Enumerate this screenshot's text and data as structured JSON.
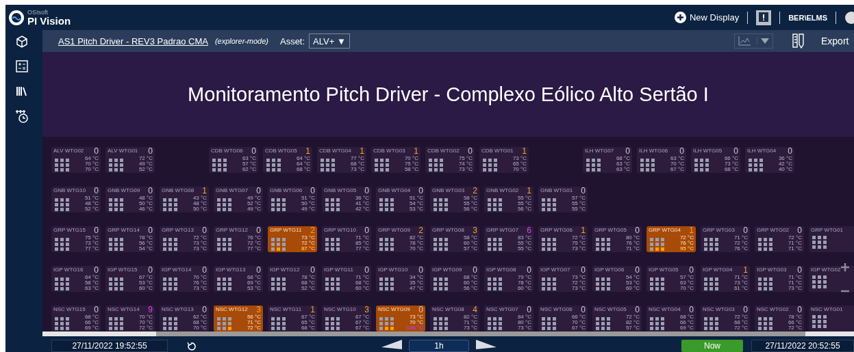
{
  "app": {
    "vendor": "OSIsoft",
    "name": "PI Vision"
  },
  "header": {
    "new_display": "New Display",
    "user": "BER\\ELMS"
  },
  "toolbar": {
    "display_link": "AS1 Pitch Driver - REV3 Padrao CMA",
    "mode": "(explorer-mode)",
    "asset_label": "Asset:",
    "asset_value": "ALV+",
    "asset_arrow": "▼",
    "export": "Export"
  },
  "display": {
    "title": "Monitoramento Pitch Driver - Complexo Eólico Alto Sertão I",
    "rows": [
      {
        "groups": [
          [
            {
              "name": "ALV WTG02",
              "count": "0",
              "color": "#d0d0d8",
              "alarm": false,
              "temps": [
                "64 °C",
                "70 °C",
                "70 °C"
              ]
            },
            {
              "name": "ALV WTG01",
              "count": "0",
              "color": "#d0d0d8",
              "alarm": false,
              "temps": [
                "72 °C",
                "49 °C",
                "52 °C"
              ]
            }
          ],
          [
            {
              "name": "CDB WTG06",
              "count": "0",
              "color": "#d0d0d8",
              "alarm": false,
              "temps": [
                "63 °C",
                "57 °C",
                "62 °C"
              ]
            },
            {
              "name": "CDB WTG05",
              "count": "1",
              "color": "#f5a623",
              "alarm": false,
              "temps": [
                "64 °C",
                "64 °C",
                "68 °C"
              ]
            },
            {
              "name": "CDB WTG04",
              "count": "1",
              "color": "#f5a623",
              "alarm": false,
              "temps": [
                "77 °C",
                "68 °C",
                "73 °C"
              ]
            },
            {
              "name": "CDB WTG03",
              "count": "1",
              "color": "#f5a623",
              "alarm": false,
              "temps": [
                "70 °C",
                "75 °C",
                "58 °C"
              ]
            },
            {
              "name": "CDB WTG02",
              "count": "0",
              "color": "#d0d0d8",
              "alarm": false,
              "temps": [
                "75 °C",
                "74 °C",
                "73 °C"
              ]
            },
            {
              "name": "CDB WTG01",
              "count": "1",
              "color": "#f5a623",
              "alarm": false,
              "temps": [
                "73 °C",
                "65 °C",
                "70 °C"
              ]
            }
          ],
          [
            {
              "name": "ILH WTG07",
              "count": "0",
              "color": "#d0d0d8",
              "alarm": false,
              "temps": [
                "68 °C",
                "63 °C",
                "63 °C"
              ]
            },
            {
              "name": "ILH WTG06",
              "count": "0",
              "color": "#d0d0d8",
              "alarm": false,
              "temps": [
                "63 °C",
                "70 °C",
                "67 °C"
              ]
            },
            {
              "name": "ILH WTG05",
              "count": "0",
              "color": "#d0d0d8",
              "alarm": false,
              "temps": [
                "66 °C",
                "73 °C",
                "68 °C"
              ]
            },
            {
              "name": "ILH WTG04",
              "count": "0",
              "color": "#d0d0d8",
              "alarm": false,
              "temps": [
                "36 °C",
                "42 °C",
                "40 °C"
              ]
            }
          ]
        ]
      },
      {
        "groups": [
          [
            {
              "name": "GNB WTG10",
              "count": "0",
              "color": "#d0d0d8",
              "alarm": false,
              "temps": [
                "51 °C",
                "48 °C",
                "52 °C"
              ]
            },
            {
              "name": "GNB WTG09",
              "count": "0",
              "color": "#d0d0d8",
              "alarm": false,
              "temps": [
                "48 °C",
                "50 °C",
                "46 °C"
              ]
            },
            {
              "name": "GNB WTG08",
              "count": "1",
              "color": "#f5a623",
              "alarm": false,
              "temps": [
                "43 °C",
                "48 °C",
                "50 °C"
              ]
            },
            {
              "name": "GNB WTG07",
              "count": "0",
              "color": "#d0d0d8",
              "alarm": false,
              "temps": [
                "49 °C",
                "52 °C",
                "49 °C"
              ]
            },
            {
              "name": "GNB WTG06",
              "count": "0",
              "color": "#d0d0d8",
              "alarm": false,
              "temps": [
                "51 °C",
                "50 °C",
                "49 °C"
              ]
            },
            {
              "name": "GNB WTG05",
              "count": "0",
              "color": "#d0d0d8",
              "alarm": false,
              "temps": [
                "36 °C",
                "41 °C",
                "42 °C"
              ]
            },
            {
              "name": "GNB WTG04",
              "count": "0",
              "color": "#d0d0d8",
              "alarm": false,
              "temps": [
                "51 °C",
                "54 °C",
                "53 °C"
              ]
            },
            {
              "name": "GNB WTG03",
              "count": "2",
              "color": "#f5a623",
              "alarm": false,
              "temps": [
                "58 °C",
                "55 °C",
                "56 °C"
              ]
            },
            {
              "name": "GNB WTG02",
              "count": "1",
              "color": "#f5a623",
              "alarm": false,
              "temps": [
                "55 °C",
                "55 °C",
                "56 °C"
              ]
            },
            {
              "name": "GNB WTG01",
              "count": "0",
              "color": "#d0d0d8",
              "alarm": false,
              "temps": [
                "57 °C",
                "55 °C",
                "55 °C"
              ]
            }
          ]
        ]
      },
      {
        "groups": [
          [
            {
              "name": "GRP WTG15",
              "count": "0",
              "color": "#d0d0d8",
              "alarm": false,
              "temps": [
                "75 °C",
                "73 °C",
                "77 °C"
              ]
            },
            {
              "name": "GRP WTG14",
              "count": "0",
              "color": "#d0d0d8",
              "alarm": false,
              "temps": [
                "78 °C",
                "56 °C",
                "54 °C"
              ]
            },
            {
              "name": "GRP WTG13",
              "count": "0",
              "color": "#d0d0d8",
              "alarm": false,
              "temps": [
                "72 °C",
                "73 °C",
                "73 °C"
              ]
            },
            {
              "name": "GRP WTG12",
              "count": "0",
              "color": "#d0d0d8",
              "alarm": false,
              "temps": [
                "76 °C",
                "72 °C",
                "77 °C"
              ]
            },
            {
              "name": "GRP WTG11",
              "count": "2",
              "color": "#f5a623",
              "alarm": true,
              "temps": [
                "73 °C",
                "72 °C",
                "87 °C"
              ],
              "temp_alert": [
                false,
                false,
                true
              ],
              "critical": false,
              "hot_cells": [
                false,
                false,
                false,
                false,
                false,
                false,
                false,
                true,
                false
              ]
            },
            {
              "name": "GRP WTG10",
              "count": "0",
              "color": "#d0d0d8",
              "alarm": false,
              "temps": [
                "71 °C",
                "85 °C",
                "77 °C"
              ]
            },
            {
              "name": "GRP WTG09",
              "count": "2",
              "color": "#f5a623",
              "alarm": false,
              "temps": [
                "82 °C",
                "78 °C",
                "70 °C"
              ]
            },
            {
              "name": "GRP WTG08",
              "count": "3",
              "color": "#f5a623",
              "alarm": false,
              "temps": [
                "58 °C",
                "60 °C",
                "57 °C"
              ]
            },
            {
              "name": "GRP WTG07",
              "count": "6",
              "color": "#e040e0",
              "alarm": false,
              "temps": [
                "83 °C",
                "55 °C",
                "55 °C"
              ]
            },
            {
              "name": "GRP WTG06",
              "count": "1",
              "color": "#f5a623",
              "alarm": false,
              "temps": [
                "72 °C",
                "75 °C",
                "73 °C"
              ]
            },
            {
              "name": "GRP WTG05",
              "count": "0",
              "color": "#d0d0d8",
              "alarm": false,
              "temps": [
                "80 °C",
                "76 °C",
                "71 °C"
              ]
            },
            {
              "name": "GRP WTG04",
              "count": "1",
              "color": "#f5a623",
              "alarm": true,
              "temps": [
                "72 °C",
                "76 °C",
                "95 °C"
              ],
              "temp_alert": [
                false,
                false,
                true
              ],
              "critical": false,
              "hot_cells": [
                false,
                false,
                false,
                false,
                false,
                false,
                false,
                true,
                true
              ]
            },
            {
              "name": "GRP WTG03",
              "count": "0",
              "color": "#d0d0d8",
              "alarm": false,
              "temps": [
                "71 °C",
                "72 °C",
                "76 °C"
              ]
            },
            {
              "name": "GRP WTG02",
              "count": "0",
              "color": "#d0d0d8",
              "alarm": false,
              "temps": [
                "72 °C",
                "71 °C",
                "71 °C"
              ]
            },
            {
              "name": "GRP WTG01",
              "alarm": false
            }
          ]
        ]
      },
      {
        "groups": [
          [
            {
              "name": "IGP WTG16",
              "count": "0",
              "color": "#d0d0d8",
              "alarm": false,
              "temps": [
                "64 °C",
                "58 °C",
                "63 °C"
              ]
            },
            {
              "name": "IGP WTG15",
              "count": "0",
              "color": "#d0d0d8",
              "alarm": false,
              "temps": [
                "67 °C",
                "53 °C",
                "60 °C"
              ]
            },
            {
              "name": "IGP WTG14",
              "count": "0",
              "color": "#d0d0d8",
              "alarm": false,
              "temps": [
                "70 °C",
                "76 °C",
                "73 °C"
              ]
            },
            {
              "name": "IGP WTG13",
              "count": "0",
              "color": "#d0d0d8",
              "alarm": false,
              "temps": [
                "68 °C",
                "69 °C",
                "53 °C"
              ]
            },
            {
              "name": "IGP WTG12",
              "count": "0",
              "color": "#d0d0d8",
              "alarm": false,
              "temps": [
                "78 °C",
                "68 °C",
                "52 °C"
              ]
            },
            {
              "name": "IGP WTG11",
              "count": "0",
              "color": "#d0d0d8",
              "alarm": false,
              "temps": [
                "71 °C",
                "68 °C",
                "60 °C"
              ]
            },
            {
              "name": "IGP WTG10",
              "count": "0",
              "color": "#d0d0d8",
              "alarm": false,
              "temps": [
                "34 °C",
                "35 °C",
                "47 °C"
              ]
            },
            {
              "name": "IGP WTG09",
              "count": "0",
              "color": "#d0d0d8",
              "alarm": false,
              "temps": [
                "68 °C",
                "60 °C",
                "56 °C"
              ]
            },
            {
              "name": "IGP WTG08",
              "count": "0",
              "color": "#d0d0d8",
              "alarm": false,
              "temps": [
                "79 °C",
                "78 °C",
                "60 °C"
              ]
            },
            {
              "name": "IGP WTG07",
              "count": "0",
              "color": "#d0d0d8",
              "alarm": false,
              "temps": [
                "73 °C",
                "72 °C",
                "73 °C"
              ]
            },
            {
              "name": "IGP WTG06",
              "count": "0",
              "color": "#d0d0d8",
              "alarm": false,
              "temps": [
                "54 °C",
                "53 °C",
                "60 °C"
              ]
            },
            {
              "name": "IGP WTG05",
              "count": "0",
              "color": "#d0d0d8",
              "alarm": false,
              "temps": [
                "57 °C",
                "63 °C",
                "70 °C"
              ]
            },
            {
              "name": "IGP WTG04",
              "count": "1",
              "color": "#f5a623",
              "alarm": false,
              "temps": [
                "71 °C",
                "73 °C",
                "61 °C"
              ]
            },
            {
              "name": "IGP WTG03",
              "count": "0",
              "color": "#d0d0d8",
              "alarm": false,
              "temps": [
                "71 °C",
                "71 °C",
                "73 °C"
              ]
            },
            {
              "name": "IGP WTG02",
              "alarm": false
            }
          ]
        ]
      },
      {
        "groups": [
          [
            {
              "name": "NSC WTG15",
              "count": "0",
              "color": "#d0d0d8",
              "alarm": false,
              "temps": [
                "68 °C",
                "66 °C",
                "69 °C"
              ]
            },
            {
              "name": "NSC WTG14",
              "count": "9",
              "color": "#e040e0",
              "alarm": false,
              "temps": [
                "70 °C",
                "70 °C",
                "72 °C"
              ]
            },
            {
              "name": "NSC WTG13",
              "count": "0",
              "color": "#d0d0d8",
              "alarm": false,
              "temps": [
                "62 °C",
                "68 °C",
                "70 °C"
              ]
            },
            {
              "name": "NSC WTG12",
              "count": "3",
              "color": "#f5a623",
              "alarm": true,
              "temps": [
                "56 °C",
                "71 °C",
                "72 °C"
              ],
              "hot_cells": [
                false,
                false,
                false,
                false,
                false,
                false,
                false,
                false,
                true
              ]
            },
            {
              "name": "NSC WTG11",
              "count": "1",
              "color": "#f5a623",
              "alarm": false,
              "temps": [
                "67 °C",
                "65 °C",
                "68 °C"
              ]
            },
            {
              "name": "NSC WTG10",
              "count": "3",
              "color": "#f5a623",
              "alarm": false,
              "temps": [
                "67 °C",
                "67 °C",
                "67 °C"
              ]
            },
            {
              "name": "NSC WTG09",
              "count": "0",
              "color": "#f0c8a0",
              "alarm": true,
              "temps": [
                "73 °C",
                "70 °C",
                "156 °C"
              ],
              "temp_alert": [
                false,
                false,
                true
              ],
              "critical": true,
              "hot_cells": [
                false,
                false,
                false,
                false,
                false,
                false,
                false,
                true,
                true
              ]
            },
            {
              "name": "NSC WTG08",
              "count": "4",
              "color": "#f5a623",
              "alarm": false,
              "temps": [
                "82 °C",
                "71 °C",
                "73 °C"
              ]
            },
            {
              "name": "NSC WTG07",
              "count": "0",
              "color": "#d0d0d8",
              "alarm": false,
              "temps": [
                "84 °C",
                "80 °C",
                "73 °C"
              ]
            },
            {
              "name": "NSC WTG06",
              "count": "0",
              "color": "#d0d0d8",
              "alarm": false,
              "temps": [
                "66 °C",
                "70 °C",
                "67 °C"
              ]
            },
            {
              "name": "NSC WTG05",
              "count": "0",
              "color": "#d0d0d8",
              "alarm": false,
              "temps": [
                "72 °C",
                "82 °C",
                "57 °C"
              ]
            },
            {
              "name": "NSC WTG04",
              "count": "0",
              "color": "#d0d0d8",
              "alarm": false,
              "temps": [
                "68 °C",
                "66 °C",
                "69 °C"
              ]
            },
            {
              "name": "NSC WTG03",
              "count": "0",
              "color": "#d0d0d8",
              "alarm": false,
              "temps": [
                "72 °C",
                "68 °C",
                "72 °C"
              ]
            },
            {
              "name": "NSC WTG02",
              "count": "0",
              "color": "#d0d0d8",
              "alarm": false,
              "temps": [
                "78 °C",
                "66 °C",
                "72 °C"
              ]
            },
            {
              "name": "NSC WTG01",
              "alarm": false
            }
          ]
        ]
      }
    ]
  },
  "timebar": {
    "start": "27/11/2022 19:52:55",
    "duration": "1h",
    "now": "Now",
    "end": "27/11/2022 20:52:55"
  }
}
